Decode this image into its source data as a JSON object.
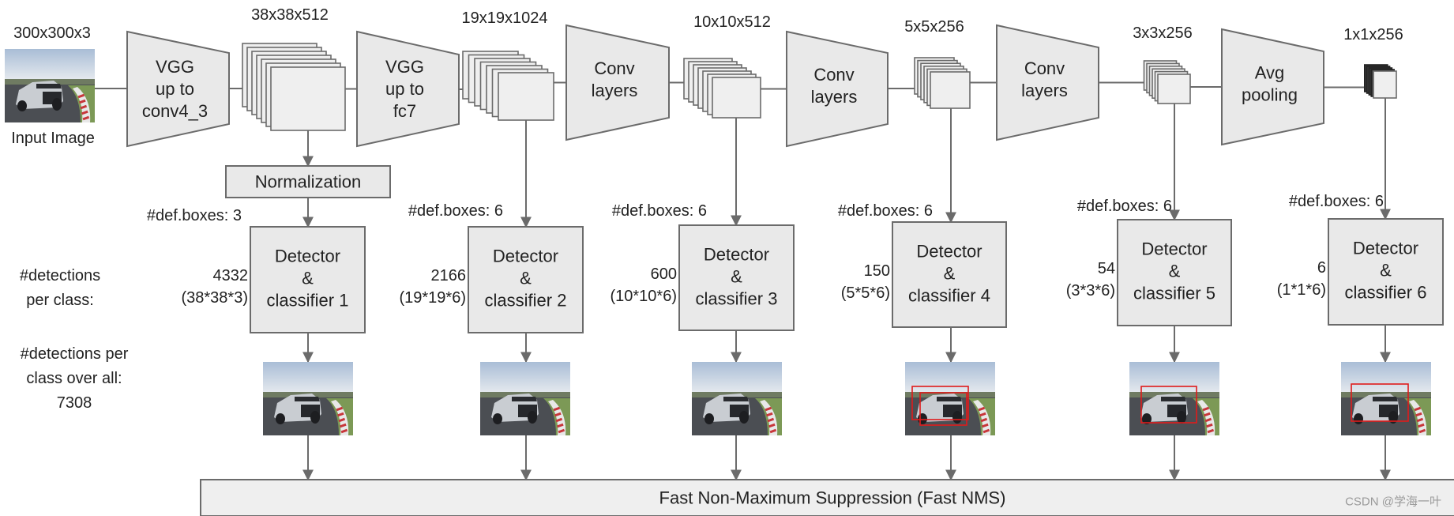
{
  "input": {
    "size_label": "300x300x3",
    "label": "Input Image"
  },
  "layers": [
    {
      "lines": [
        "VGG",
        "up to",
        "conv4_3"
      ]
    },
    {
      "lines": [
        "VGG",
        "up to",
        "fc7"
      ]
    },
    {
      "lines": [
        "Conv",
        "layers"
      ]
    },
    {
      "lines": [
        "Conv",
        "layers"
      ]
    },
    {
      "lines": [
        "Conv",
        "layers"
      ]
    },
    {
      "lines": [
        "Avg",
        "pooling"
      ]
    }
  ],
  "feature_maps": [
    "38x38x512",
    "19x19x1024",
    "10x10x512",
    "5x5x256",
    "3x3x256",
    "1x1x256"
  ],
  "normalization": "Normalization",
  "branches": [
    {
      "def_boxes": "#def.boxes: 3",
      "count": "4332",
      "formula": "(38*38*3)",
      "detector": [
        "Detector",
        "&",
        "classifier 1"
      ]
    },
    {
      "def_boxes": "#def.boxes: 6",
      "count": "2166",
      "formula": "(19*19*6)",
      "detector": [
        "Detector",
        "&",
        "classifier 2"
      ]
    },
    {
      "def_boxes": "#def.boxes: 6",
      "count": "600",
      "formula": "(10*10*6)",
      "detector": [
        "Detector",
        "&",
        "classifier 3"
      ]
    },
    {
      "def_boxes": "#def.boxes: 6",
      "count": "150",
      "formula": "(5*5*6)",
      "detector": [
        "Detector",
        "&",
        "classifier 4"
      ]
    },
    {
      "def_boxes": "#def.boxes: 6",
      "count": "54",
      "formula": "(3*3*6)",
      "detector": [
        "Detector",
        "&",
        "classifier 5"
      ]
    },
    {
      "def_boxes": "#def.boxes: 6",
      "count": "6",
      "formula": "(1*1*6)",
      "detector": [
        "Detector",
        "&",
        "classifier 6"
      ]
    }
  ],
  "row_labels": {
    "per_class": [
      "#detections",
      "per class:"
    ],
    "overall": [
      "#detections per",
      "class over all:",
      "7308"
    ]
  },
  "nms": "Fast Non-Maximum Suppression (Fast NMS)",
  "watermark": "CSDN @学海一叶",
  "colors": {
    "shape_fill": "#e9e9e9",
    "stroke": "#6b6b6b",
    "detection_box": "#e01b1b",
    "watermark": "#9a9a9a"
  }
}
